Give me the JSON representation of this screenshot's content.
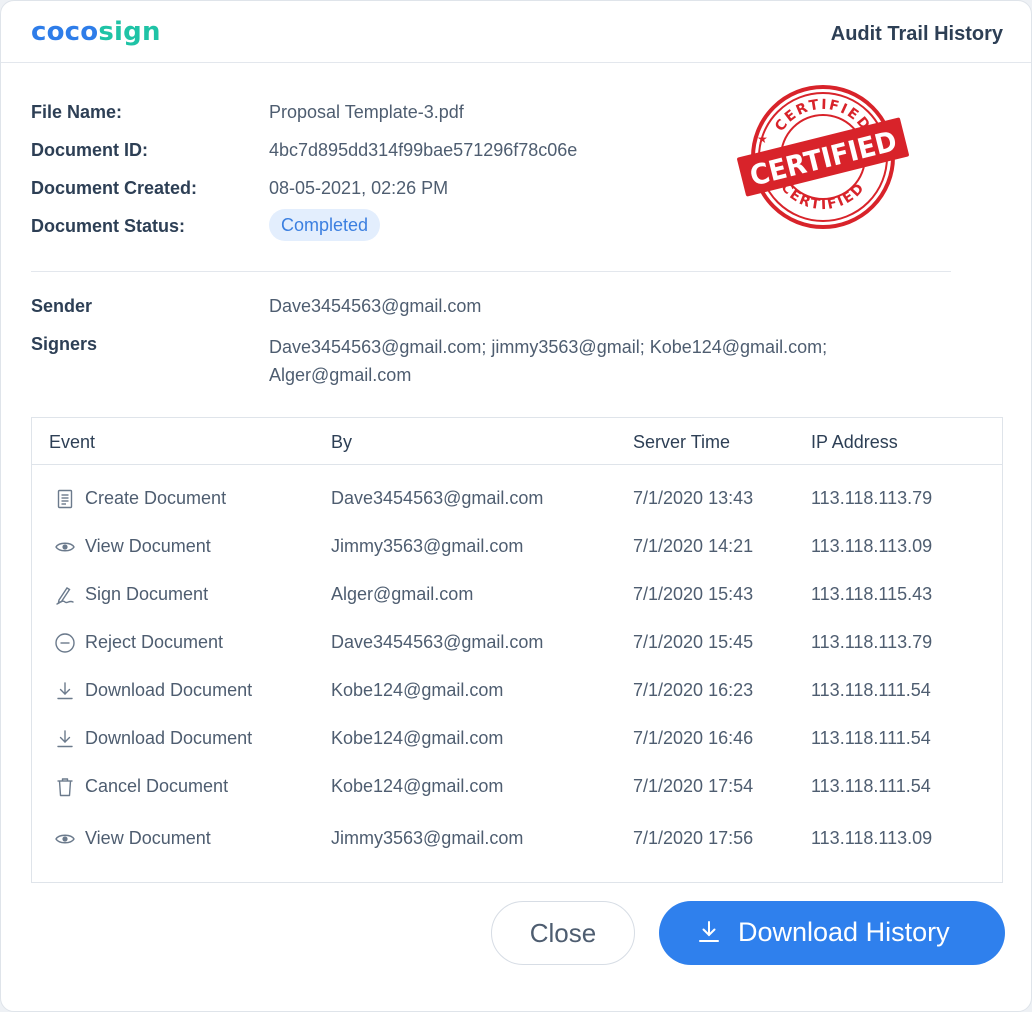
{
  "header": {
    "logo_part1": "coco",
    "logo_part2": "sign",
    "title": "Audit Trail History"
  },
  "document_info": {
    "file_name_label": "File Name:",
    "file_name": "Proposal Template-3.pdf",
    "document_id_label": "Document ID:",
    "document_id": "4bc7d895dd314f99bae571296f78c06e",
    "created_label": "Document Created:",
    "created": "08-05-2021, 02:26 PM",
    "status_label": "Document Status:",
    "status": "Completed"
  },
  "stamp": {
    "text_arc": "CERTIFIED",
    "text_center": "CERTIFIED",
    "color": "#d8232a"
  },
  "parties": {
    "sender_label": "Sender",
    "sender": "Dave3454563@gmail.com",
    "signers_label": "Signers",
    "signers": "Dave3454563@gmail.com; jimmy3563@gmail; Kobe124@gmail.com; Alger@gmail.com"
  },
  "table": {
    "headers": {
      "event": "Event",
      "by": "By",
      "time": "Server Time",
      "ip": "IP Address"
    },
    "rows": [
      {
        "icon": "document-icon",
        "event": "Create Document",
        "by": "Dave3454563@gmail.com",
        "time": "7/1/2020 13:43",
        "ip": "113.118.113.79"
      },
      {
        "icon": "eye-icon",
        "event": "View Document",
        "by": "Jimmy3563@gmail.com",
        "time": "7/1/2020 14:21",
        "ip": "113.118.113.09"
      },
      {
        "icon": "signature-pen-icon",
        "event": "Sign Document",
        "by": "Alger@gmail.com",
        "time": "7/1/2020 15:43",
        "ip": "113.118.115.43"
      },
      {
        "icon": "reject-circle-icon",
        "event": "Reject Document",
        "by": "Dave3454563@gmail.com",
        "time": "7/1/2020 15:45",
        "ip": "113.118.113.79"
      },
      {
        "icon": "download-icon",
        "event": "Download Document",
        "by": "Kobe124@gmail.com",
        "time": "7/1/2020 16:23",
        "ip": "113.118.111.54"
      },
      {
        "icon": "download-icon",
        "event": "Download Document",
        "by": "Kobe124@gmail.com",
        "time": "7/1/2020 16:46",
        "ip": "113.118.111.54"
      },
      {
        "icon": "trash-icon",
        "event": "Cancel Document",
        "by": "Kobe124@gmail.com",
        "time": "7/1/2020 17:54",
        "ip": "113.118.111.54"
      },
      {
        "icon": "eye-icon",
        "event": "View Document",
        "by": "Jimmy3563@gmail.com",
        "time": "7/1/2020 17:56",
        "ip": "113.118.113.09"
      }
    ]
  },
  "footer": {
    "close_label": "Close",
    "download_label": "Download History"
  },
  "colors": {
    "primary": "#2f80ed",
    "logo_blue": "#2e7de9",
    "logo_green": "#1fc3a6",
    "status_bg": "#e3eefd",
    "status_text": "#3b7fe0"
  }
}
